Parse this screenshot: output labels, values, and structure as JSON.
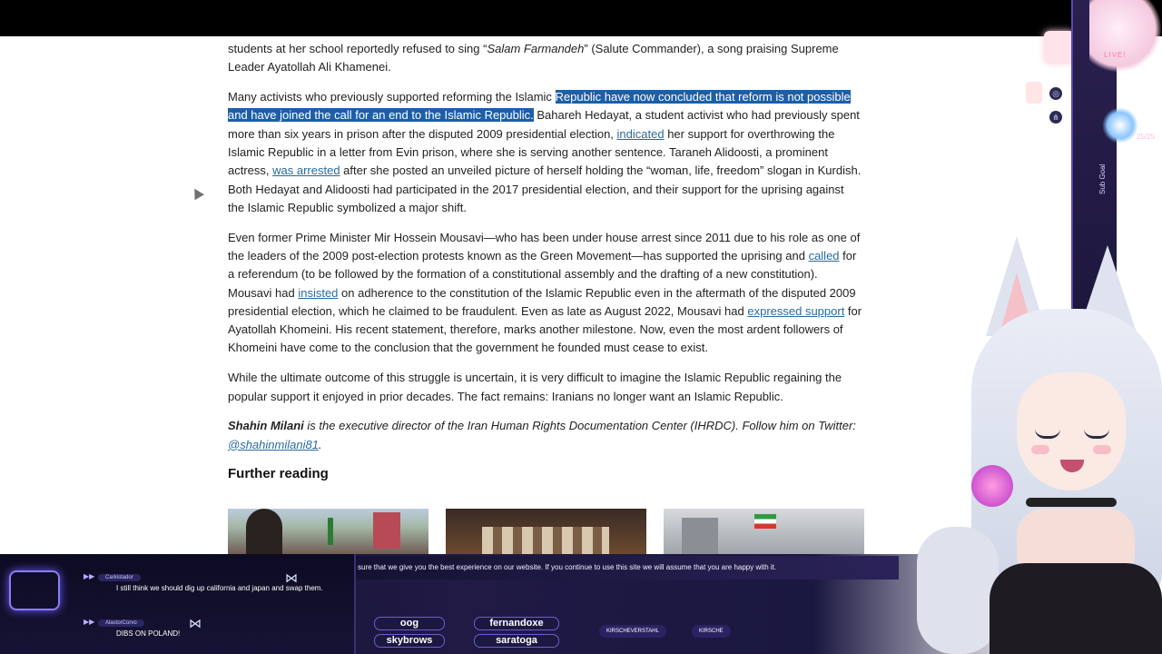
{
  "article": {
    "partial_line": "students at her school reportedly refused to sing “",
    "partial_song": "Salam Farmandeh",
    "partial_line_rest": "” (Salute Commander), a song praising Supreme Leader Ayatollah Ali Khamenei.",
    "p2": {
      "pre": "Many activists who previously supported reforming the Islamic ",
      "highlight": "Republic have now concluded that reform is not possible and have joined the call for an end to the Islamic Republic.",
      "mid1": " Bahareh Hedayat, a student activist who had previously spent more than six years in prison after the disputed 2009 presidential election, ",
      "link1": "indicated",
      "mid2": " her support for overthrowing the Islamic Republic in a letter from Evin prison, where she is serving another sentence. Taraneh Alidoosti, a prominent actress, ",
      "link2": "was arrested",
      "post": " after she posted an unveiled picture of herself holding the “woman, life, freedom” slogan in Kurdish. Both Hedayat and Alidoosti had participated in the 2017 presidential election, and their support for the uprising against the Islamic Republic symbolized a major shift."
    },
    "p3": {
      "pre": "Even former Prime Minister Mir Hossein Mousavi—who has been under house arrest since 2011 due to his role as one of the leaders of the 2009 post-election protests known as the Green Movement—has supported the uprising and ",
      "link1": "called",
      "mid1": " for a referendum (to be followed by the formation of a constitutional assembly and the drafting of a new constitution). Mousavi had ",
      "link2": "insisted",
      "mid2": " on adherence to the constitution of the Islamic Republic even in the aftermath of the disputed 2009 presidential election, which he claimed to be fraudulent. Even as late as August 2022, Mousavi had ",
      "link3": "expressed support",
      "post": " for Ayatollah Khomeini. His recent statement, therefore, marks another milestone. Now, even the most ardent followers of Khomeini have come to the conclusion that the government he founded must cease to exist."
    },
    "p4": "While the ultimate outcome of this struggle is uncertain, it is very difficult to imagine the Islamic Republic regaining the popular support it enjoyed in prior decades. The fact remains: Iranians no longer want an Islamic Republic.",
    "byline": {
      "author": "Shahin Milani",
      "text": " is the executive director of the Iran Human Rights Documentation Center (IHRDC). Follow him on Twitter: ",
      "handle": "@shahinmilani81",
      "end": "."
    },
    "further_reading": "Further reading"
  },
  "overlay": {
    "cookie": "sure that we give you the best experience on our website. If you continue to use this site we will assume that you are happy with it.",
    "chat": [
      {
        "user": "Carkistador",
        "text": "I still think we should dig up california and japan and swap them."
      },
      {
        "user": "AlastorCorvo",
        "text": "DIBS ON POLAND!"
      }
    ],
    "tags": [
      "oog",
      "fernandoxe",
      "skybrows",
      "saratoga"
    ],
    "social": [
      "KIRSCHEVERSTAHL",
      "KIRSCHE"
    ],
    "live": "LIVE!",
    "sub_goal": "Sub Goal",
    "counter": "25/25"
  },
  "colors": {
    "highlight": "#1b5fa8",
    "link": "#2a6aa0",
    "overlay": "#1a1740"
  }
}
